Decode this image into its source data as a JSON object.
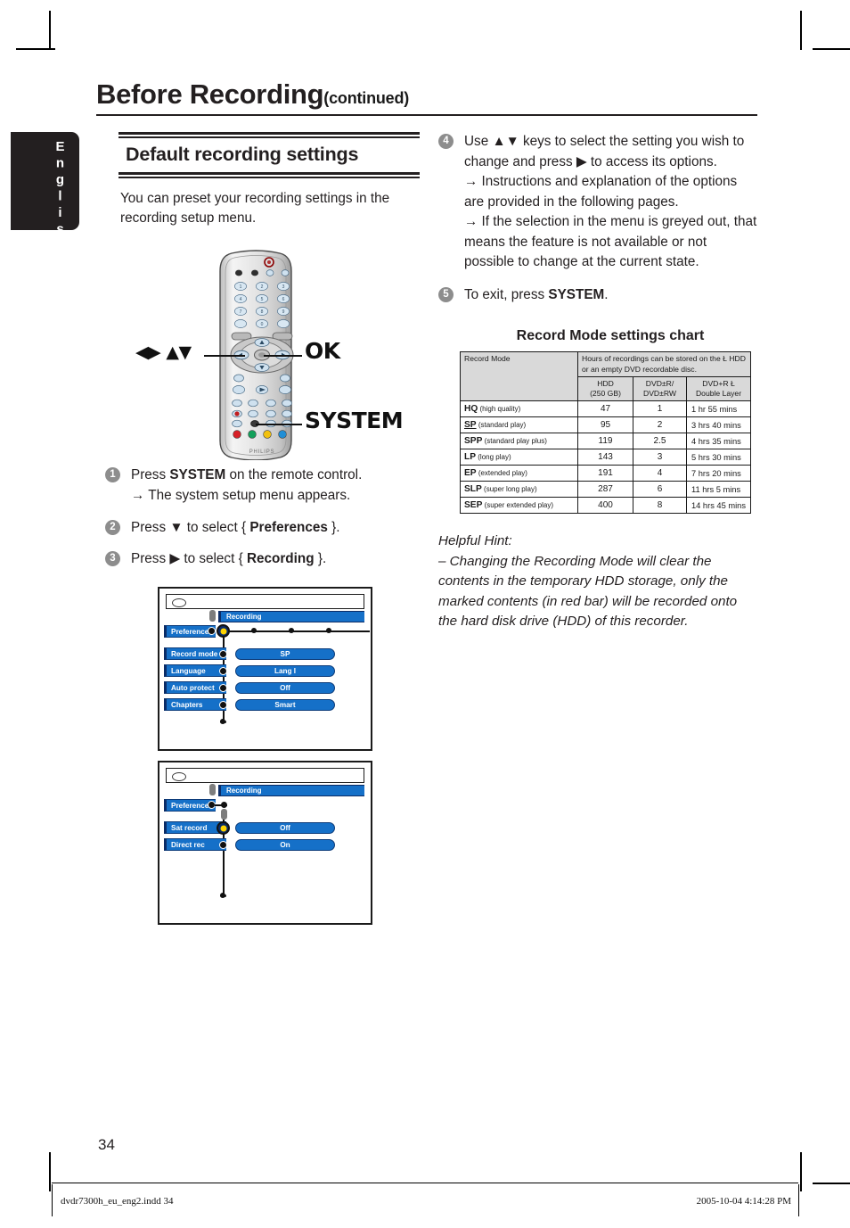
{
  "page": {
    "language_tab": "English",
    "title": "Before Recording",
    "title_continued": "(continued)",
    "page_number": "34"
  },
  "left_column": {
    "section_heading": "Default recording settings",
    "intro": "You can preset your recording settings in the recording setup menu.",
    "remote_callouts": {
      "nav_keys": "◀▶ ▲▼",
      "ok": "OK",
      "system": "SYSTEM",
      "brand": "PHILIPS"
    },
    "steps": [
      {
        "num": "1",
        "text_before": "Press ",
        "bold": "SYSTEM",
        "text_after": " on the remote control.",
        "sub": "→ The system setup menu appears."
      },
      {
        "num": "2",
        "text_before": "Press ▼ to select { ",
        "bold": "Preferences",
        "text_after": " }.",
        "sub": ""
      },
      {
        "num": "3",
        "text_before": "Press ▶ to select { ",
        "bold": "Recording",
        "text_after": " }.",
        "sub": ""
      }
    ]
  },
  "osd_screen_1": {
    "title_bar": "Recording",
    "parent_item": "Preferences",
    "items": [
      {
        "label": "Record mode",
        "option": "SP"
      },
      {
        "label": "Language",
        "option": "Lang I"
      },
      {
        "label": "Auto protect",
        "option": "Off"
      },
      {
        "label": "Chapters",
        "option": "Smart"
      }
    ]
  },
  "osd_screen_2": {
    "title_bar": "Recording",
    "parent_item": "Preferences",
    "items": [
      {
        "label": "Sat record",
        "option": "Off"
      },
      {
        "label": "Direct rec",
        "option": "On"
      }
    ]
  },
  "right_column": {
    "steps": [
      {
        "num": "4",
        "line1": "Use ▲▼ keys to select the setting you wish to change and press ▶ to access its options.",
        "sub1": "→ Instructions and explanation of the options are provided in the following pages.",
        "sub2": "→ If the selection in the menu is greyed out, that means the feature is not available or not possible to change at the current state."
      },
      {
        "num": "5",
        "text_before": "To exit, press ",
        "bold": "SYSTEM",
        "text_after": "."
      }
    ],
    "hint": {
      "label": "Helpful Hint:",
      "body": "– Changing the Recording Mode will clear the contents in the temporary HDD storage, only the marked contents (in red bar) will be recorded onto the hard disk drive (HDD) of this recorder."
    }
  },
  "chart_data": {
    "type": "table",
    "title": "Record Mode settings chart",
    "header_col1": "Record Mode",
    "header_span": "Hours of recordings can be stored on the Ł HDD or an empty DVD recordable disc.",
    "subheaders": [
      "HDD\n(250 GB)",
      "DVD±R/\nDVD±RW",
      "DVD+R Ł\nDouble Layer"
    ],
    "columns": [
      "Record Mode",
      "HDD (250 GB)",
      "DVD±R/DVD±RW",
      "DVD+R Ł Double Layer"
    ],
    "rows": [
      {
        "abbr": "HQ",
        "desc": "(high quality)",
        "underline": false,
        "hdd": "47",
        "dvd": "1",
        "dual": "1 hr 55 mins"
      },
      {
        "abbr": "SP",
        "desc": "(standard play)",
        "underline": true,
        "hdd": "95",
        "dvd": "2",
        "dual": "3 hrs 40 mins"
      },
      {
        "abbr": "SPP",
        "desc": "(standard play plus)",
        "underline": false,
        "hdd": "119",
        "dvd": "2.5",
        "dual": "4 hrs 35 mins"
      },
      {
        "abbr": "LP",
        "desc": "(long play)",
        "underline": false,
        "hdd": "143",
        "dvd": "3",
        "dual": "5 hrs 30 mins"
      },
      {
        "abbr": "EP",
        "desc": "(extended play)",
        "underline": false,
        "hdd": "191",
        "dvd": "4",
        "dual": "7 hrs 20 mins"
      },
      {
        "abbr": "SLP",
        "desc": "(super long play)",
        "underline": false,
        "hdd": "287",
        "dvd": "6",
        "dual": "11 hrs 5 mins"
      },
      {
        "abbr": "SEP",
        "desc": "(super extended play)",
        "underline": false,
        "hdd": "400",
        "dvd": "8",
        "dual": "14 hrs 45 mins"
      }
    ]
  },
  "footer": {
    "file": "dvdr7300h_eu_eng2.indd   34",
    "timestamp": "2005-10-04   4:14:28 PM"
  },
  "colors": {
    "osd_blue": "#1570c8",
    "osd_navy": "#0b2c66",
    "selected_yellow": "#ffd400",
    "tab_black": "#231f20",
    "table_header_grey": "#d9d9d9"
  }
}
